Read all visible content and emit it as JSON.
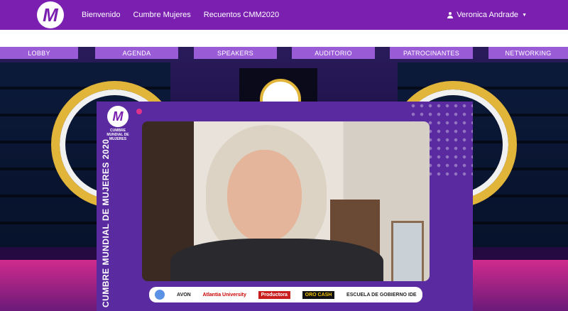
{
  "header": {
    "logo_letter": "M",
    "nav": [
      "Bienvenido",
      "Cumbre Mujeres",
      "Recuentos CMM2020"
    ],
    "user_name": "Veronica Andrade"
  },
  "tabs": [
    "LOBBY",
    "AGENDA",
    "SPEAKERS",
    "AUDITORIO",
    "PATROCINANTES",
    "NETWORKING"
  ],
  "frame": {
    "logo_text": "CUMBRE MUNDIAL DE MUJERES",
    "vertical_title": "CUMBRE MUNDIAL DE MUJERES 2020"
  },
  "sponsors": [
    "AVON",
    "Atlantia University",
    "Productora",
    "ORO CASH",
    "ESCUELA DE GOBIERNO IDE"
  ]
}
